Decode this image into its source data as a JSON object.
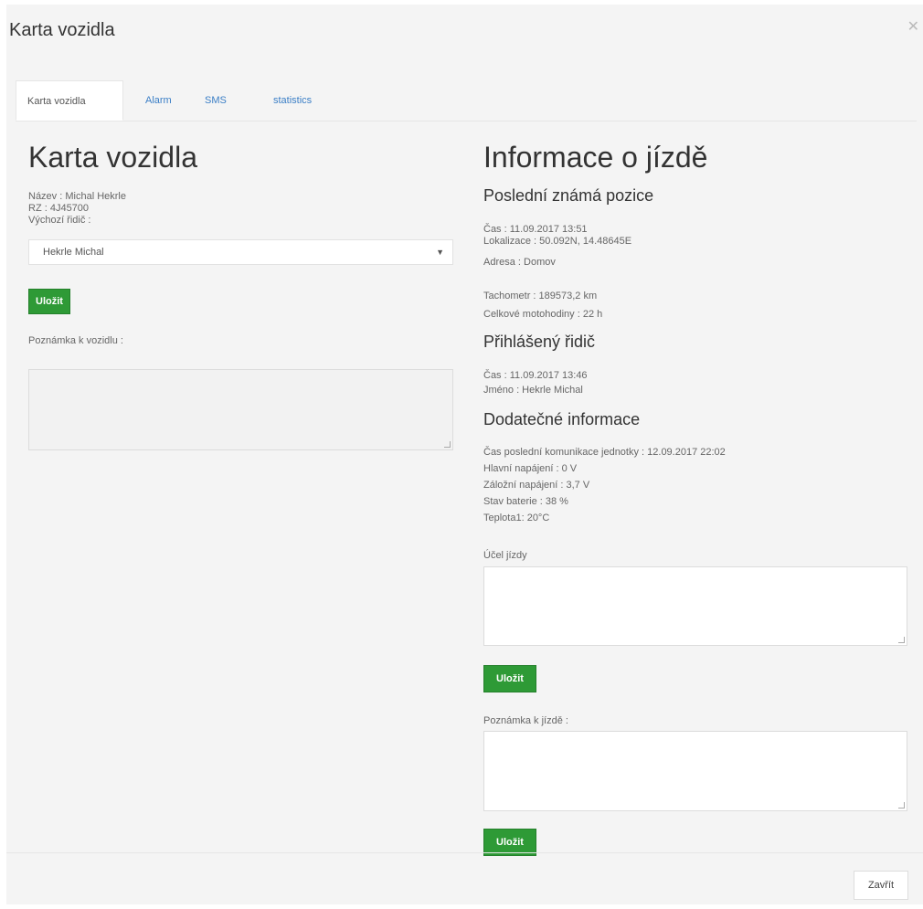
{
  "modal": {
    "title": "Karta vozidla"
  },
  "tabs": [
    "Karta vozidla",
    "Alarm",
    "SMS",
    "statistics"
  ],
  "left": {
    "heading": "Karta vozidla",
    "name_line": "Název : Michal Hekrle",
    "rz_line": "RZ : 4J45700",
    "default_driver_label": "Výchozí řidič :",
    "driver_select_value": "Hekrle Michal",
    "save_label": "Uložit",
    "note_label": "Poznámka k vozidlu :"
  },
  "right": {
    "heading": "Informace o jízdě",
    "last_position": {
      "title": "Poslední známá pozice",
      "time": "Čas : 11.09.2017 13:51",
      "location": "Lokalizace : 50.092N, 14.48645E",
      "address": "Adresa : Domov"
    },
    "odometer": "Tachometr : 189573,2 km",
    "engine_hours": "Celkové motohodiny : 22 h",
    "driver": {
      "title": "Přihlášený řidič",
      "time": "Čas : 11.09.2017 13:46",
      "name": "Jméno : Hekrle Michal"
    },
    "additional": {
      "title": "Dodatečné informace",
      "last_comm": "Čas poslední komunikace jednotky : 12.09.2017 22:02",
      "main_power": "Hlavní napájení : 0 V",
      "backup_power": "Záložní napájení : 3,7 V",
      "battery": "Stav baterie : 38 %",
      "temp": "Teplota1: 20°C"
    },
    "trip_purpose_label": "Účel jízdy",
    "save_label_1": "Uložit",
    "trip_note_label": "Poznámka k jízdě :",
    "save_label_2": "Uložit"
  },
  "footer": {
    "close_label": "Zavřít"
  }
}
